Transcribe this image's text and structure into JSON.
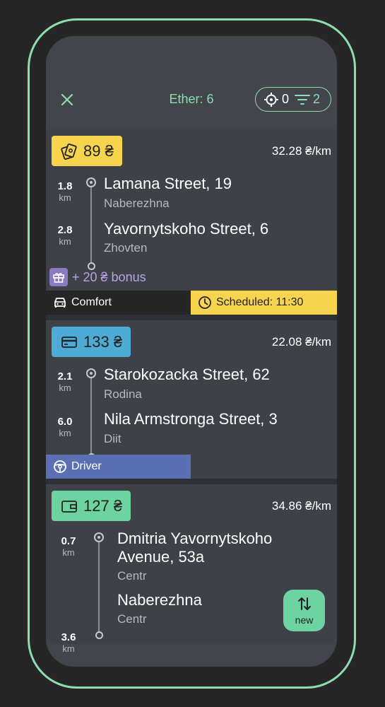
{
  "header": {
    "ether_label": "Ether: 6",
    "location_count": "0",
    "filter_count": "2"
  },
  "orders": [
    {
      "price_icon": "cash-icon",
      "price": "89 ₴",
      "price_color": "#f6d44d",
      "rate": "32.28 ₴/km",
      "pickup": {
        "distance": "1.8",
        "unit": "km",
        "address": "Lamana Street, 19",
        "area": "Naberezhna"
      },
      "dropoff": {
        "distance": "2.8",
        "unit": "km",
        "address": "Yavornytskoho Street, 6",
        "area": "Zhovten"
      },
      "bonus": "+ 20 ₴ bonus",
      "class_tag": "Comfort",
      "schedule_tag": "Scheduled: 11:30"
    },
    {
      "price_icon": "card-icon",
      "price": "133 ₴",
      "price_color": "#4eabd6",
      "rate": "22.08 ₴/km",
      "pickup": {
        "distance": "2.1",
        "unit": "km",
        "address": "Starokozacka Street, 62",
        "area": "Rodina"
      },
      "dropoff": {
        "distance": "6.0",
        "unit": "km",
        "address": "Nila Armstronga Street, 3",
        "area": "Diit"
      },
      "class_tag": "Driver"
    },
    {
      "price_icon": "wallet-icon",
      "price": "127 ₴",
      "price_color": "#6dd3a0",
      "rate": "34.86 ₴/km",
      "pickup": {
        "distance": "0.7",
        "unit": "km",
        "address_line1": "Dmitria Yavornytskoho",
        "address_line2": "Avenue, 53a",
        "area": "Centr"
      },
      "dropoff": {
        "distance": "3.6",
        "unit": "km",
        "address": "Naberezhna",
        "area": "Centr"
      }
    }
  ],
  "new_button": {
    "label": "new",
    "icon": "swap-vertical-icon"
  },
  "colors": {
    "accent": "#8fdcaf",
    "background": "#262626",
    "card": "#3f4149",
    "bonus": "#b9a3e6",
    "tag_dark": "#262626",
    "tag_scheduled": "#f6d44d",
    "tag_driver": "#5b6fb4"
  }
}
